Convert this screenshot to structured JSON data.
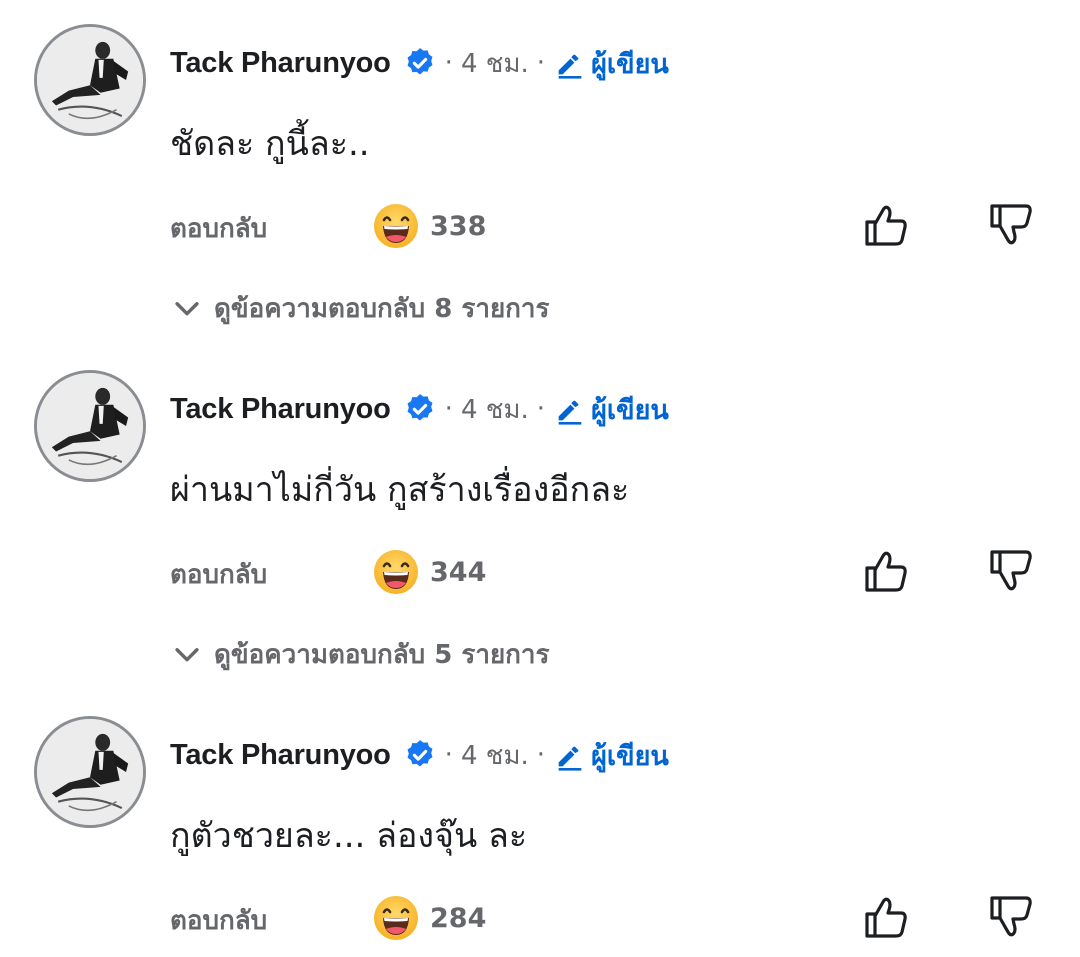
{
  "comments": [
    {
      "author": "Tack Pharunyoo",
      "separator_1": "·",
      "time": "4 ชม.",
      "separator_2": "·",
      "author_badge": "ผู้เขียน",
      "text": "ชัดละ กูนี้ละ..",
      "reply_label": "ตอบกลับ",
      "reaction_icon": "haha-emoji-icon",
      "reaction_count": "338",
      "view_replies": "ดูข้อความตอบกลับ 8 รายการ"
    },
    {
      "author": "Tack Pharunyoo",
      "separator_1": "·",
      "time": "4 ชม.",
      "separator_2": "·",
      "author_badge": "ผู้เขียน",
      "text": "ผ่านมาไม่กี่วัน กูสร้างเรื่องอีกละ",
      "reply_label": "ตอบกลับ",
      "reaction_icon": "haha-emoji-icon",
      "reaction_count": "344",
      "view_replies": "ดูข้อความตอบกลับ 5 รายการ"
    },
    {
      "author": "Tack Pharunyoo",
      "separator_1": "·",
      "time": "4 ชม.",
      "separator_2": "·",
      "author_badge": "ผู้เขียน",
      "text": "กูตัวชวยละ... ล่องจุ๊น ละ",
      "reply_label": "ตอบกลับ",
      "reaction_icon": "haha-emoji-icon",
      "reaction_count": "284"
    }
  ],
  "colors": {
    "text_primary": "#1c1e21",
    "text_secondary": "#65676b",
    "accent_blue": "#0064d1",
    "verified_blue": "#1877f2",
    "haha_yellow": "#f7b125"
  }
}
